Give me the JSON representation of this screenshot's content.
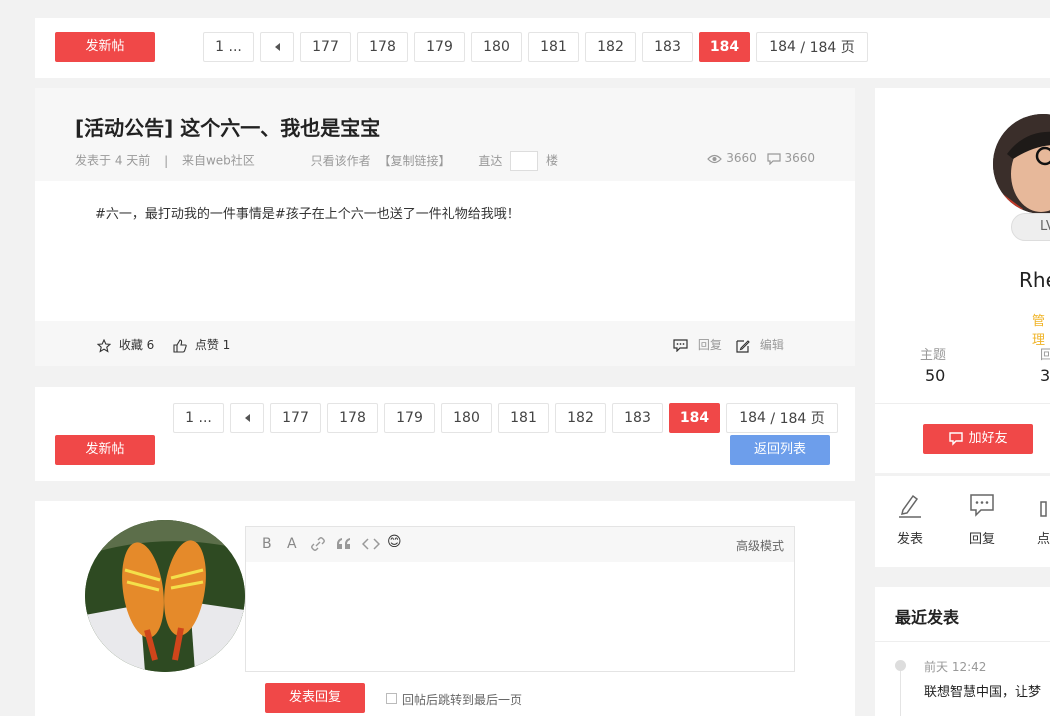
{
  "toolbar": {
    "new_post_label": "发新帖"
  },
  "pager": {
    "first_label": "1 ...",
    "pages": [
      "177",
      "178",
      "179",
      "180",
      "181",
      "182",
      "183"
    ],
    "current": "184",
    "total_current": "184",
    "total_suffix": " / 184 页"
  },
  "post": {
    "title": "[活动公告] 这个六一、我也是宝宝",
    "posted": "发表于 4 天前",
    "sep": "|",
    "source": "来自web社区",
    "only_author": "只看该作者",
    "copy_link": "【复制链接】",
    "goto_label": "直达",
    "floor_label": "楼",
    "views": "3660",
    "replies": "3660",
    "content": "#六一，最打动我的一件事情是#孩子在上个六一也送了一件礼物给我哦！",
    "favorite_label": "收藏 6",
    "like_label": "点赞 1",
    "reply_label": "回复",
    "edit_label": "编辑"
  },
  "bottom": {
    "back_label": "返回列表"
  },
  "editor": {
    "tools": [
      "B",
      "A"
    ],
    "advanced_label": "高级模式",
    "submit_label": "发表回复",
    "jump_label": "回帖后跳转到最后一页",
    "emoji": "😊"
  },
  "profile": {
    "level_badge": "LV",
    "name": "Rhe",
    "role": "管理",
    "stats": [
      {
        "label": "主题",
        "value": "50"
      },
      {
        "label": "回",
        "value": "3"
      }
    ],
    "add_friend_label": "加好友",
    "actions": [
      {
        "label": "发表"
      },
      {
        "label": "回复"
      },
      {
        "label": "点"
      }
    ]
  },
  "recent": {
    "title": "最近发表",
    "items": [
      {
        "time": "前天 12:42",
        "text": "联想智慧中国，让梦"
      }
    ]
  },
  "colors": {
    "accent": "#f04848",
    "blue": "#6d9eeb",
    "gold": "#f0b429"
  }
}
